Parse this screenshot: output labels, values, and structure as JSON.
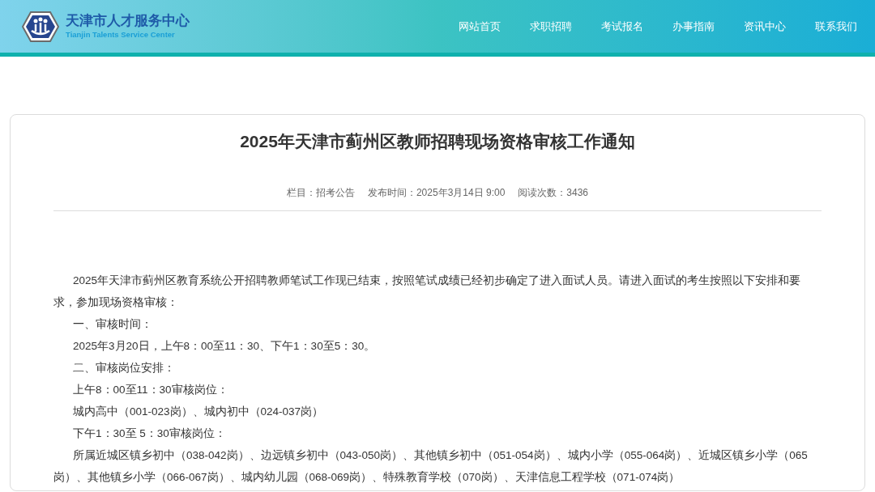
{
  "header": {
    "site_name": "天津市人才服务中心",
    "site_name_en": "Tianjin Talents Service Center",
    "nav": [
      {
        "label": "网站首页"
      },
      {
        "label": "求职招聘"
      },
      {
        "label": "考试报名"
      },
      {
        "label": "办事指南"
      },
      {
        "label": "资讯中心"
      },
      {
        "label": "联系我们"
      }
    ]
  },
  "article": {
    "title": "2025年天津市蓟州区教师招聘现场资格审核工作通知",
    "meta": [
      "栏目：招考公告",
      "发布时间：2025年3月14日 9:00",
      "阅读次数：3436"
    ],
    "paragraphs": [
      "2025年天津市蓟州区教育系统公开招聘教师笔试工作现已结束，按照笔试成绩已经初步确定了进入面试人员。请进入面试的考生按照以下安排和要求，参加现场资格审核：",
      "一、审核时间：",
      "2025年3月20日，上午8：00至11：30、下午1：30至5：30。",
      "二、审核岗位安排：",
      "上午8：00至11：30审核岗位：",
      "城内高中（001-023岗）、城内初中（024-037岗）",
      "下午1：30至 5：30审核岗位：",
      "所属近城区镇乡初中（038-042岗）、边远镇乡初中（043-050岗）、其他镇乡初中（051-054岗）、城内小学（055-064岗）、近城区镇乡小学（065岗）、其他镇乡小学（066-067岗）、城内幼儿园（068-069岗）、特殊教育学校（070岗）、天津信息工程学校（071-074岗）"
    ]
  }
}
